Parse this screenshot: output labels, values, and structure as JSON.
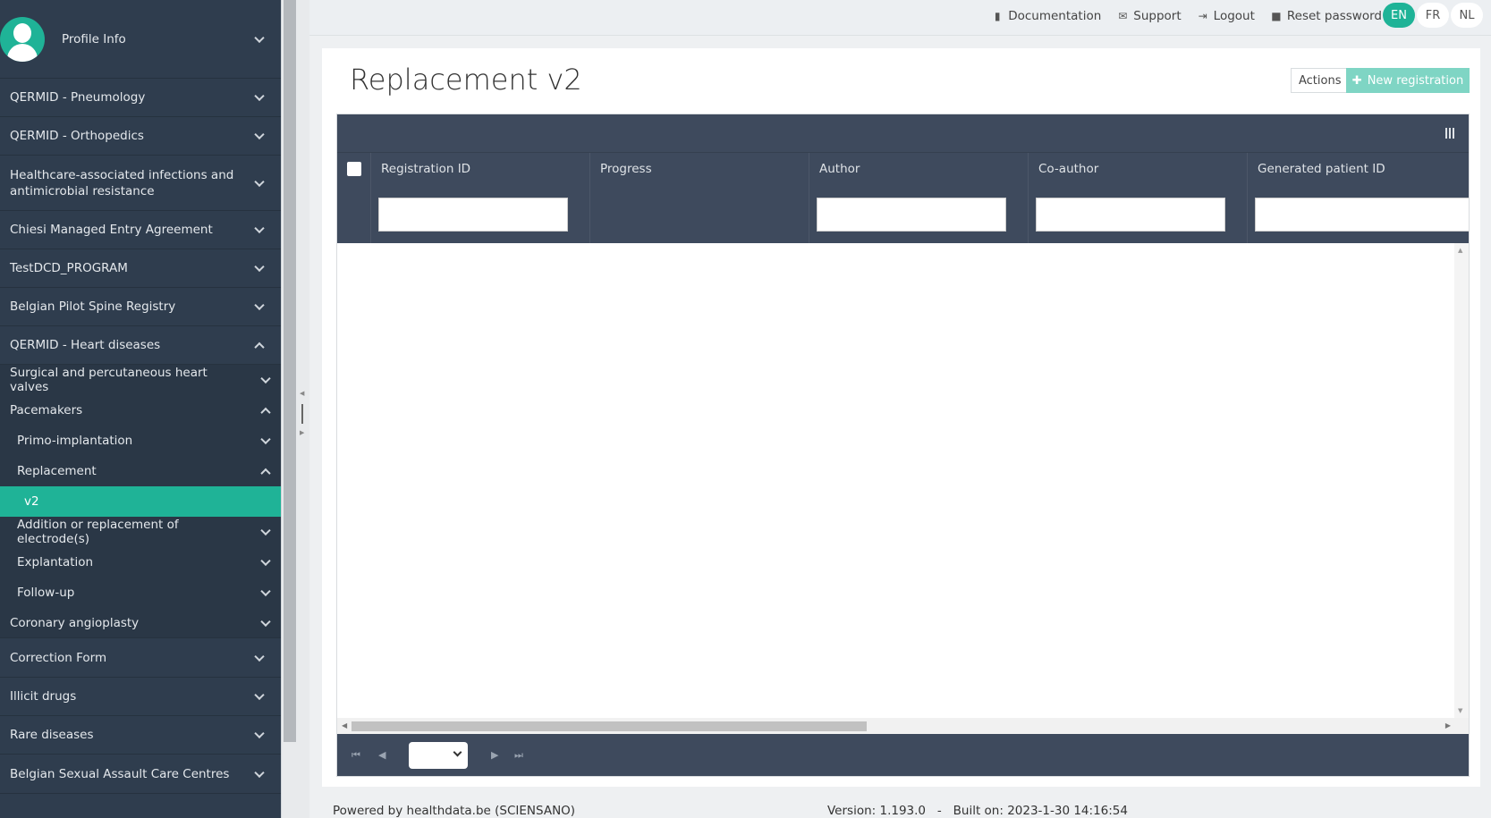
{
  "sidebar": {
    "profile_label": "Profile Info",
    "items": [
      {
        "label": "QERMID - Pneumology"
      },
      {
        "label": "QERMID - Orthopedics"
      },
      {
        "label": "Healthcare-associated infections and antimicrobial resistance"
      },
      {
        "label": "Chiesi Managed Entry Agreement"
      },
      {
        "label": "TestDCD_PROGRAM"
      },
      {
        "label": "Belgian Pilot Spine Registry"
      },
      {
        "label": "QERMID - Heart diseases"
      }
    ],
    "heart_children": [
      {
        "label": "Surgical and percutaneous heart valves"
      },
      {
        "label": "Pacemakers"
      }
    ],
    "pacemaker_children": [
      {
        "label": "Primo-implantation"
      },
      {
        "label": "Replacement"
      }
    ],
    "replacement_children": [
      {
        "label": "v2"
      }
    ],
    "pacemaker_more": [
      {
        "label": "Addition or replacement of electrode(s)"
      },
      {
        "label": "Explantation"
      },
      {
        "label": "Follow-up"
      }
    ],
    "heart_more": [
      {
        "label": "Coronary angioplasty"
      }
    ],
    "bottom_items": [
      {
        "label": "Correction Form"
      },
      {
        "label": "Illicit drugs"
      },
      {
        "label": "Rare diseases"
      },
      {
        "label": "Belgian Sexual Assault Care Centres"
      }
    ]
  },
  "topbar": {
    "documentation": "Documentation",
    "support": "Support",
    "logout": "Logout",
    "reset_password": "Reset password",
    "languages": [
      "EN",
      "FR",
      "NL"
    ],
    "active_language": "EN"
  },
  "main": {
    "title": "Replacement v2",
    "actions_label": "Actions",
    "new_registration_label": "New registration",
    "columns": [
      "Registration ID",
      "Progress",
      "Author",
      "Co-author",
      "Generated patient ID"
    ]
  },
  "footer": {
    "powered_by": "Powered by healthdata.be (SCIENSANO)",
    "version": "Version: 1.193.0   -   Built on: 2023-1-30 14:16:54"
  },
  "colors": {
    "sidebar_bg": "#2f3d4e",
    "accent": "#1fb397",
    "grid_header": "#3e4a5d"
  }
}
